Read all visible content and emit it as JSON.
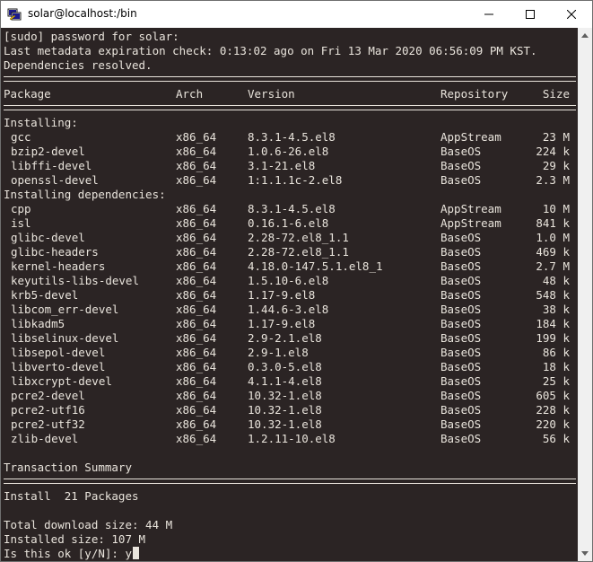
{
  "window": {
    "title": "solar@localhost:/bin",
    "icon": "putty-terminal-icon",
    "minimize_glyph": "—",
    "maximize_glyph": "☐",
    "close_glyph": "✕"
  },
  "colors": {
    "terminal_bg": "#2b2424",
    "terminal_fg": "#e9e4dc",
    "chrome_bg": "#ffffff",
    "scrollbar_bg": "#f0f0f0"
  },
  "terminal": {
    "intro": [
      "[sudo] password for solar:",
      "Last metadata expiration check: 0:13:02 ago on Fri 13 Mar 2020 06:56:09 PM KST.",
      "Dependencies resolved."
    ],
    "headers": {
      "package": "Package",
      "arch": "Arch",
      "version": "Version",
      "repository": "Repository",
      "size": "Size"
    },
    "section_installing": "Installing:",
    "installing": [
      {
        "package": "gcc",
        "arch": "x86_64",
        "version": "8.3.1-4.5.el8",
        "repo": "AppStream",
        "size": "23 M"
      },
      {
        "package": "bzip2-devel",
        "arch": "x86_64",
        "version": "1.0.6-26.el8",
        "repo": "BaseOS",
        "size": "224 k"
      },
      {
        "package": "libffi-devel",
        "arch": "x86_64",
        "version": "3.1-21.el8",
        "repo": "BaseOS",
        "size": "29 k"
      },
      {
        "package": "openssl-devel",
        "arch": "x86_64",
        "version": "1:1.1.1c-2.el8",
        "repo": "BaseOS",
        "size": "2.3 M"
      }
    ],
    "section_dependencies": "Installing dependencies:",
    "dependencies": [
      {
        "package": "cpp",
        "arch": "x86_64",
        "version": "8.3.1-4.5.el8",
        "repo": "AppStream",
        "size": "10 M"
      },
      {
        "package": "isl",
        "arch": "x86_64",
        "version": "0.16.1-6.el8",
        "repo": "AppStream",
        "size": "841 k"
      },
      {
        "package": "glibc-devel",
        "arch": "x86_64",
        "version": "2.28-72.el8_1.1",
        "repo": "BaseOS",
        "size": "1.0 M"
      },
      {
        "package": "glibc-headers",
        "arch": "x86_64",
        "version": "2.28-72.el8_1.1",
        "repo": "BaseOS",
        "size": "469 k"
      },
      {
        "package": "kernel-headers",
        "arch": "x86_64",
        "version": "4.18.0-147.5.1.el8_1",
        "repo": "BaseOS",
        "size": "2.7 M"
      },
      {
        "package": "keyutils-libs-devel",
        "arch": "x86_64",
        "version": "1.5.10-6.el8",
        "repo": "BaseOS",
        "size": "48 k"
      },
      {
        "package": "krb5-devel",
        "arch": "x86_64",
        "version": "1.17-9.el8",
        "repo": "BaseOS",
        "size": "548 k"
      },
      {
        "package": "libcom_err-devel",
        "arch": "x86_64",
        "version": "1.44.6-3.el8",
        "repo": "BaseOS",
        "size": "38 k"
      },
      {
        "package": "libkadm5",
        "arch": "x86_64",
        "version": "1.17-9.el8",
        "repo": "BaseOS",
        "size": "184 k"
      },
      {
        "package": "libselinux-devel",
        "arch": "x86_64",
        "version": "2.9-2.1.el8",
        "repo": "BaseOS",
        "size": "199 k"
      },
      {
        "package": "libsepol-devel",
        "arch": "x86_64",
        "version": "2.9-1.el8",
        "repo": "BaseOS",
        "size": "86 k"
      },
      {
        "package": "libverto-devel",
        "arch": "x86_64",
        "version": "0.3.0-5.el8",
        "repo": "BaseOS",
        "size": "18 k"
      },
      {
        "package": "libxcrypt-devel",
        "arch": "x86_64",
        "version": "4.1.1-4.el8",
        "repo": "BaseOS",
        "size": "25 k"
      },
      {
        "package": "pcre2-devel",
        "arch": "x86_64",
        "version": "10.32-1.el8",
        "repo": "BaseOS",
        "size": "605 k"
      },
      {
        "package": "pcre2-utf16",
        "arch": "x86_64",
        "version": "10.32-1.el8",
        "repo": "BaseOS",
        "size": "228 k"
      },
      {
        "package": "pcre2-utf32",
        "arch": "x86_64",
        "version": "10.32-1.el8",
        "repo": "BaseOS",
        "size": "220 k"
      },
      {
        "package": "zlib-devel",
        "arch": "x86_64",
        "version": "1.2.11-10.el8",
        "repo": "BaseOS",
        "size": "56 k"
      }
    ],
    "transaction_summary": "Transaction Summary",
    "install_line": "Install  21 Packages",
    "total_download": "Total download size: 44 M",
    "installed_size": "Installed size: 107 M",
    "prompt": "Is this ok [y/N]: ",
    "prompt_input": "y"
  },
  "scrollbar": {
    "up_glyph": "▲",
    "down_glyph": "▼"
  }
}
